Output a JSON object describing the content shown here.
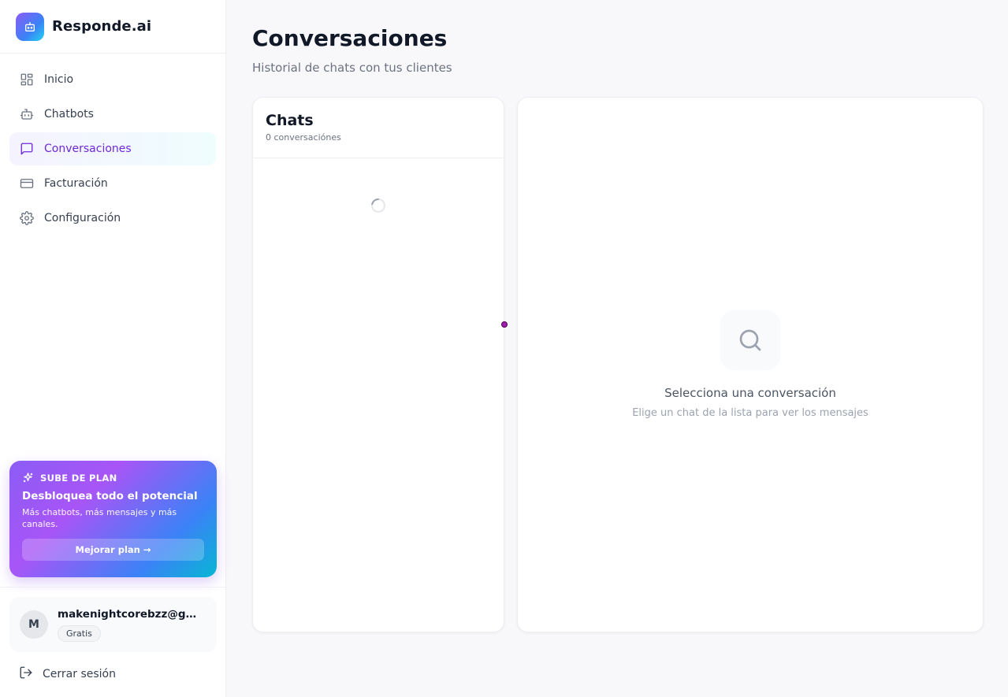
{
  "brand": {
    "name": "Responde.ai"
  },
  "nav": {
    "items": [
      {
        "label": "Inicio",
        "icon": "dashboard-grid-icon",
        "active": false
      },
      {
        "label": "Chatbots",
        "icon": "robot-icon",
        "active": false
      },
      {
        "label": "Conversaciones",
        "icon": "chat-bubble-icon",
        "active": true
      },
      {
        "label": "Facturación",
        "icon": "credit-card-icon",
        "active": false
      },
      {
        "label": "Configuración",
        "icon": "gear-icon",
        "active": false
      }
    ]
  },
  "upgrade": {
    "badge": "SUBE DE PLAN",
    "title": "Desbloquea todo el potencial",
    "description": "Más chatbots, más mensajes y más canales.",
    "button": "Mejorar plan →"
  },
  "user": {
    "initial": "M",
    "email": "makenightcorebzz@gmail.com",
    "plan": "Gratis"
  },
  "logout": {
    "label": "Cerrar sesión"
  },
  "page": {
    "title": "Conversaciones",
    "subtitle": "Historial de chats con tus clientes"
  },
  "chat_list": {
    "title": "Chats",
    "count": "0 conversaciónes"
  },
  "detail": {
    "empty_title": "Selecciona una conversación",
    "empty_description": "Elige un chat de la lista para ver los mensajes"
  },
  "colors": {
    "accent": "#6d28d9",
    "brand_gradient_start": "#8b5cf6",
    "brand_gradient_end": "#06b6d4",
    "background": "#f8f8fb"
  }
}
